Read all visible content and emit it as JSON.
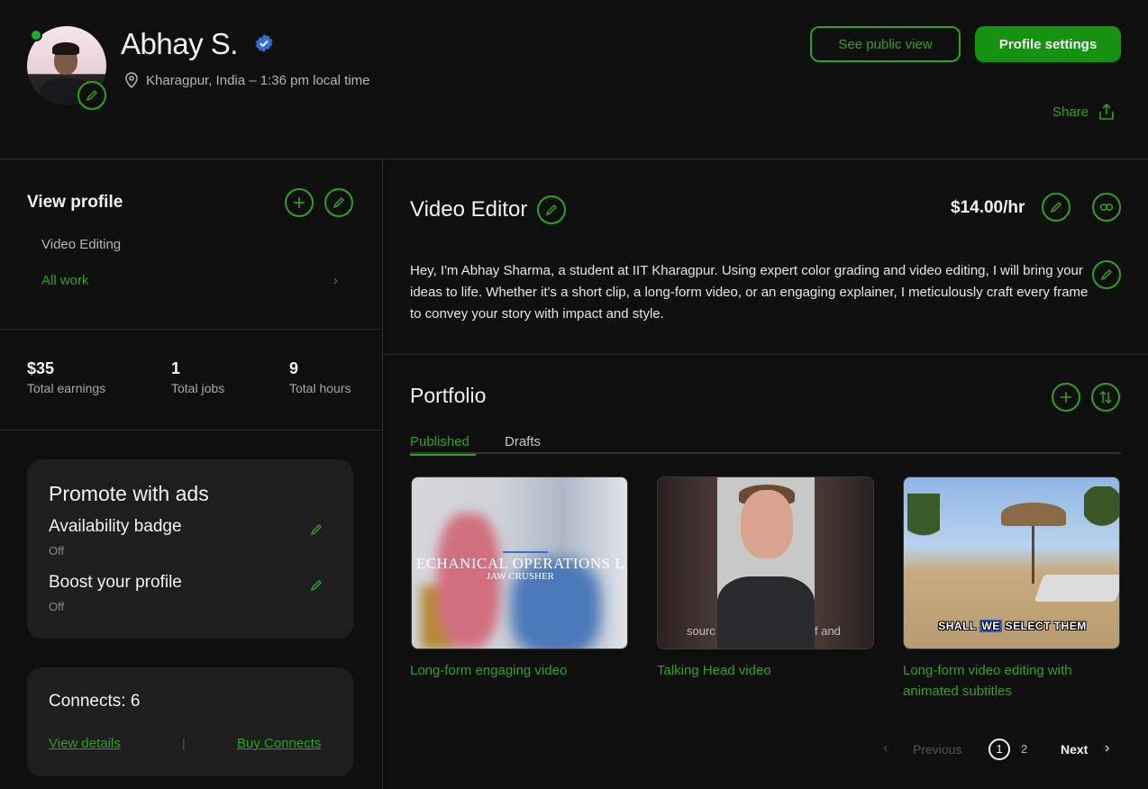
{
  "header": {
    "name": "Abhay S.",
    "location": "Kharagpur, India – 1:36 pm local time",
    "public_view_label": "See public view",
    "profile_settings_label": "Profile settings",
    "share_label": "Share"
  },
  "sidebar": {
    "view_profile_title": "View profile",
    "specialized": [
      {
        "label": "Video Editing"
      },
      {
        "label": "All work"
      }
    ],
    "stats": [
      {
        "value": "$35",
        "label": "Total earnings"
      },
      {
        "value": "1",
        "label": "Total jobs"
      },
      {
        "value": "9",
        "label": "Total hours"
      }
    ],
    "promote": {
      "title": "Promote with ads",
      "items": [
        {
          "label": "Availability badge",
          "status": "Off"
        },
        {
          "label": "Boost your profile",
          "status": "Off"
        }
      ]
    },
    "connects": {
      "title": "Connects: 6",
      "view_details": "View details",
      "separator": "|",
      "buy": "Buy Connects"
    }
  },
  "main": {
    "title": "Video Editor",
    "rate": "$14.00/hr",
    "bio": "Hey, I'm Abhay Sharma, a student at IIT Kharagpur. Using expert color grading and video editing, I will bring your ideas to life. Whether it's a short clip, a long-form video, or an engaging explainer, I meticulously craft every frame to convey your story with impact and style."
  },
  "portfolio": {
    "title": "Portfolio",
    "tabs": [
      "Published",
      "Drafts"
    ],
    "items": [
      {
        "title": "Long-form engaging video",
        "thumb_text_1": "ECHANICAL OPERATIONS L",
        "thumb_text_2": "JAW CRUSHER"
      },
      {
        "title": "Talking Head video",
        "thumb_caption_left": "sourc",
        "thumb_caption_right": "f and"
      },
      {
        "title": "Long-form video editing with animated subtitles",
        "thumb_caption": [
          "SHALL",
          "WE",
          "SELECT THEM"
        ]
      }
    ],
    "pagination": {
      "previous": "Previous",
      "pages": [
        "1",
        "2"
      ],
      "next": "Next"
    }
  },
  "colors": {
    "accent": "#2ea319",
    "primary_button": "#149210",
    "background": "#0f0f10",
    "card": "#1e1e1f",
    "verified": "#2f6fd6"
  },
  "icons": [
    "edit-icon",
    "verified-icon",
    "location-pin-icon",
    "share-icon",
    "plus-icon",
    "link-icon",
    "sort-icon",
    "chevron-right-icon",
    "chevron-left-icon"
  ]
}
